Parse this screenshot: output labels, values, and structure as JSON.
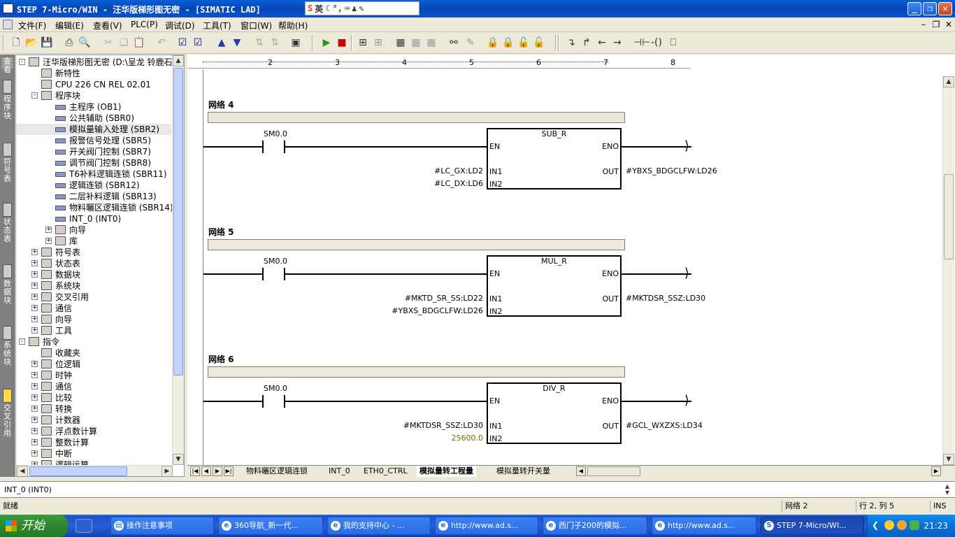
{
  "window": {
    "title": "STEP 7-Micro/WIN - 汪华版梯形图无密 - [SIMATIC LAD]"
  },
  "ime": {
    "label": "英"
  },
  "menu": [
    {
      "label": "文件(F)"
    },
    {
      "label": "编辑(E)"
    },
    {
      "label": "查看(V)"
    },
    {
      "label": "PLC(P)"
    },
    {
      "label": "调试(D)"
    },
    {
      "label": "工具(T)"
    },
    {
      "label": "窗口(W)"
    },
    {
      "label": "帮助(H)"
    }
  ],
  "left_strip": [
    "程序块",
    "符号表",
    "状态表",
    "数据块",
    "系统块",
    "交叉引用"
  ],
  "tree": [
    {
      "label": "汪华版梯形图无密 (D:\\呈龙 铃鹿石",
      "level": 0,
      "pm": "-"
    },
    {
      "label": "新特性",
      "level": 1
    },
    {
      "label": "CPU 226 CN REL 02.01",
      "level": 1
    },
    {
      "label": "程序块",
      "level": 1,
      "pm": "-"
    },
    {
      "label": "主程序 (OB1)",
      "level": 2,
      "prog": true
    },
    {
      "label": "公共辅助 (SBR0)",
      "level": 2,
      "prog": true
    },
    {
      "label": "模拟量输入处理 (SBR2)",
      "level": 2,
      "prog": true,
      "selected": true
    },
    {
      "label": "报警信号处理 (SBR5)",
      "level": 2,
      "prog": true
    },
    {
      "label": "开关阀门控制 (SBR7)",
      "level": 2,
      "prog": true
    },
    {
      "label": "调节阀门控制 (SBR8)",
      "level": 2,
      "prog": true
    },
    {
      "label": "T6补料逻辑连锁 (SBR11)",
      "level": 2,
      "prog": true
    },
    {
      "label": "逻辑连锁 (SBR12)",
      "level": 2,
      "prog": true
    },
    {
      "label": "二层补料逻辑 (SBR13)",
      "level": 2,
      "prog": true
    },
    {
      "label": "物料曬区逻辑连锁 (SBR14)",
      "level": 2,
      "prog": true
    },
    {
      "label": "INT_0 (INT0)",
      "level": 2,
      "prog": true
    },
    {
      "label": "向导",
      "level": 2,
      "pm": "+"
    },
    {
      "label": "库",
      "level": 2,
      "pm": "+"
    },
    {
      "label": "符号表",
      "level": 1,
      "pm": "+"
    },
    {
      "label": "状态表",
      "level": 1,
      "pm": "+"
    },
    {
      "label": "数据块",
      "level": 1,
      "pm": "+"
    },
    {
      "label": "系统块",
      "level": 1,
      "pm": "+"
    },
    {
      "label": "交叉引用",
      "level": 1,
      "pm": "+"
    },
    {
      "label": "通信",
      "level": 1,
      "pm": "+"
    },
    {
      "label": "向导",
      "level": 1,
      "pm": "+"
    },
    {
      "label": "工具",
      "level": 1,
      "pm": "+"
    },
    {
      "label": "指令",
      "level": 0,
      "pm": "-"
    },
    {
      "label": "收藏夹",
      "level": 1
    },
    {
      "label": "位逻辑",
      "level": 1,
      "pm": "+"
    },
    {
      "label": "时钟",
      "level": 1,
      "pm": "+"
    },
    {
      "label": "通信",
      "level": 1,
      "pm": "+"
    },
    {
      "label": "比较",
      "level": 1,
      "pm": "+"
    },
    {
      "label": "转换",
      "level": 1,
      "pm": "+"
    },
    {
      "label": "计数器",
      "level": 1,
      "pm": "+"
    },
    {
      "label": "浮点数计算",
      "level": 1,
      "pm": "+"
    },
    {
      "label": "整数计算",
      "level": 1,
      "pm": "+"
    },
    {
      "label": "中断",
      "level": 1,
      "pm": "+"
    },
    {
      "label": "逻辑运算",
      "level": 1,
      "pm": "+"
    }
  ],
  "ruler_ticks": [
    "2",
    "3",
    "4",
    "5",
    "6",
    "7",
    "8"
  ],
  "networks": [
    {
      "label": "网络 4",
      "contact": "SM0.0",
      "box": "SUB_R",
      "in1": "#LC_GX:LD2",
      "in2": "#LC_DX:LD6",
      "out": "#YBXS_BDGCLFW:LD26",
      "in2_const": false
    },
    {
      "label": "网络 5",
      "contact": "SM0.0",
      "box": "MUL_R",
      "in1": "#MKTD_SR_SS:LD22",
      "in2": "#YBXS_BDGCLFW:LD26",
      "out": "#MKTDSR_SSZ:LD30",
      "in2_const": false
    },
    {
      "label": "网络 6",
      "contact": "SM0.0",
      "box": "DIV_R",
      "in1": "#MKTDSR_SSZ:LD30",
      "in2": "25600.0",
      "out": "#GCL_WXZXS:LD34",
      "in2_const": true
    }
  ],
  "pins": {
    "en": "EN",
    "eno": "ENO",
    "in1": "IN1",
    "in2": "IN2",
    "out": "OUT"
  },
  "tabs": [
    "物料曬区逻辑连锁",
    "INT_0",
    "ETH0_CTRL",
    "模拟量转工程量",
    "模拟量转开关量"
  ],
  "active_tab": "模拟量转工程量",
  "output_text": "INT_0 (INT0)",
  "status": {
    "ready": "就绪",
    "network": "网络 2",
    "position": "行 2, 列 5",
    "mode": "INS"
  },
  "taskbar": {
    "start": "开始",
    "tasks": [
      {
        "label": "操作注意事项",
        "icon": "folder-icon"
      },
      {
        "label": "360导航_新一代...",
        "icon": "ie-icon"
      },
      {
        "label": "我的支持中心 - ...",
        "icon": "ie-icon"
      },
      {
        "label": "http://www.ad.s...",
        "icon": "ie-icon"
      },
      {
        "label": "西门子200的模拟...",
        "icon": "ie-icon"
      },
      {
        "label": "http://www.ad.s...",
        "icon": "ie-icon"
      },
      {
        "label": "STEP 7-Micro/WI...",
        "icon": "step7-icon",
        "active": true
      }
    ],
    "clock": "21:23"
  }
}
